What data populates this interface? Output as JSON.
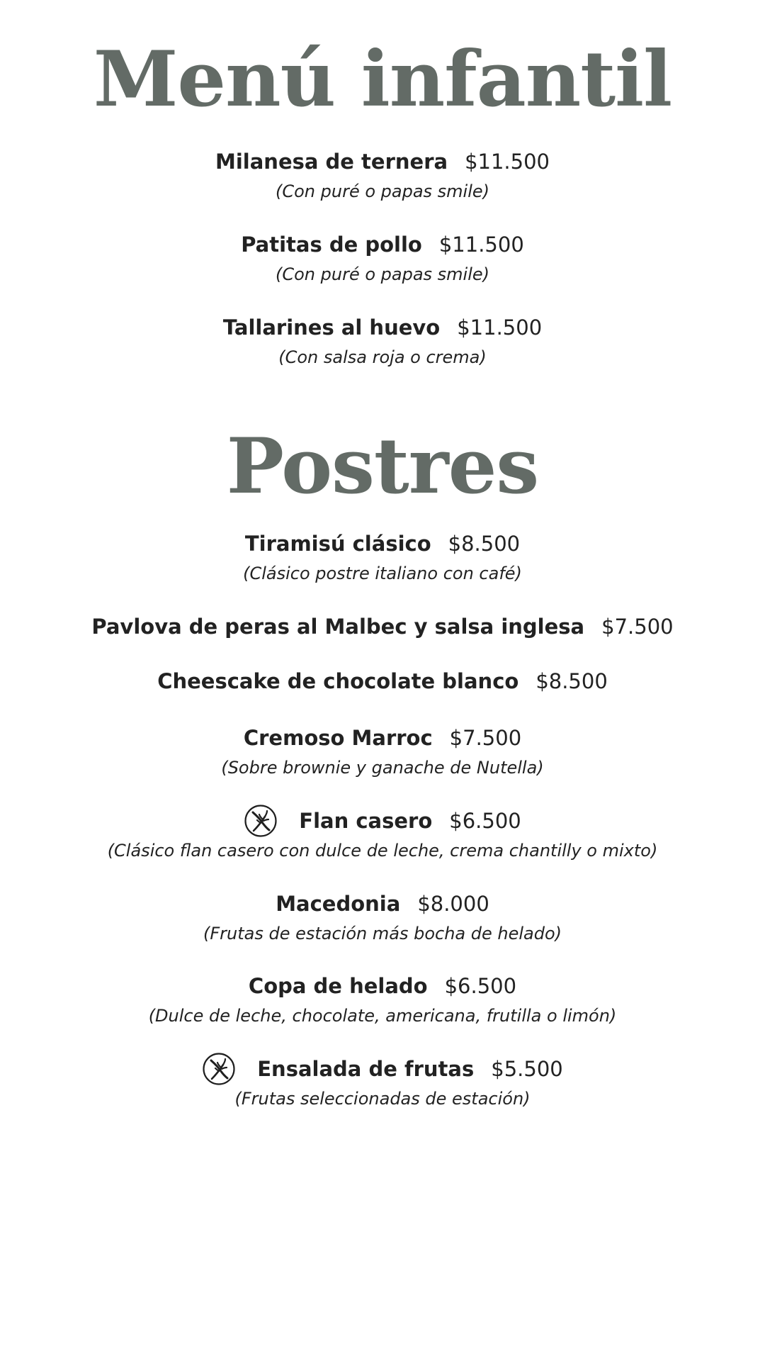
{
  "kids_menu": {
    "title": "Menú infantil",
    "items": [
      {
        "name": "Milanesa de ternera",
        "price": "$11.500",
        "desc": "(Con puré o papas smile)"
      },
      {
        "name": "Patitas de pollo",
        "price": "$11.500",
        "desc": "(Con puré o papas smile)"
      },
      {
        "name": "Tallarines al huevo",
        "price": "$11.500",
        "desc": "(Con salsa roja o crema)"
      }
    ]
  },
  "desserts": {
    "title": "Postres",
    "items": [
      {
        "name": "Tiramisú clásico",
        "price": "$8.500",
        "desc": "(Clásico postre italiano con café)"
      },
      {
        "name": "Pavlova de peras al Malbec y salsa inglesa",
        "price": "$7.500"
      },
      {
        "name": "Cheescake de chocolate blanco",
        "price": "$8.500"
      },
      {
        "name": "Cremoso Marroc",
        "price": "$7.500",
        "desc": "(Sobre brownie y ganache de Nutella)"
      },
      {
        "name": "Flan casero",
        "price": "$6.500",
        "desc": "(Clásico flan casero con dulce de leche, crema chantilly o mixto)",
        "icon": "gluten-free-icon"
      },
      {
        "name": "Macedonia",
        "price": "$8.000",
        "desc": "(Frutas de estación más bocha de helado)"
      },
      {
        "name": "Copa de helado",
        "price": "$6.500",
        "desc": "(Dulce de leche, chocolate, americana, frutilla o limón)"
      },
      {
        "name": "Ensalada de frutas",
        "price": "$5.500",
        "desc": "(Frutas seleccionadas de estación)",
        "icon": "gluten-free-icon"
      }
    ]
  },
  "colors": {
    "title": "#636b66",
    "text": "#222222",
    "background": "#ffffff"
  }
}
